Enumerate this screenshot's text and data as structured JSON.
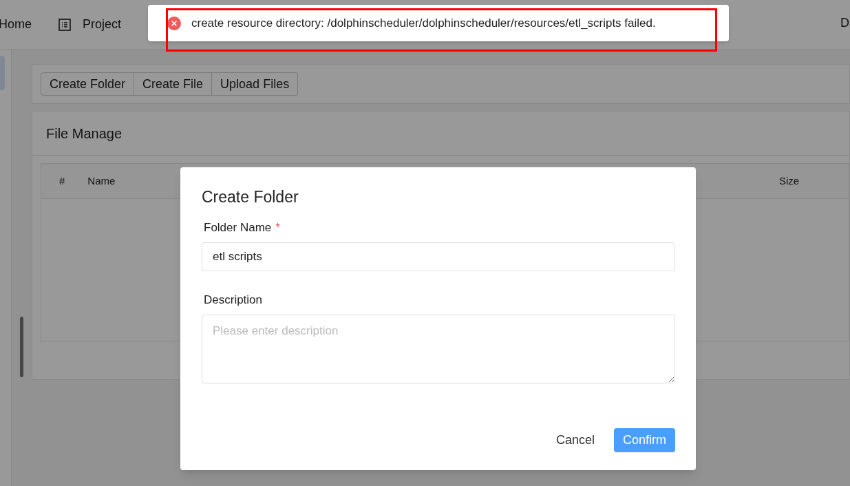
{
  "nav": {
    "items": [
      {
        "label": "Home",
        "kind": "plain"
      },
      {
        "label": "Project",
        "kind": "icon"
      }
    ],
    "user": "D"
  },
  "sidebar": {
    "items": [
      {
        "selected": true
      }
    ]
  },
  "toolbar": {
    "buttons": [
      "Create Folder",
      "Create File",
      "Upload Files"
    ]
  },
  "file_manage": {
    "title": "File Manage",
    "columns": [
      "#",
      "Name",
      "Size"
    ]
  },
  "dialog": {
    "title": "Create Folder",
    "fields": [
      {
        "kind": "input",
        "label": "Folder Name",
        "required_mark": "*",
        "value": "etl scripts"
      },
      {
        "kind": "textarea",
        "label": "Description",
        "placeholder": "Please enter description"
      }
    ],
    "buttons": [
      {
        "label": "Cancel",
        "kind": "text"
      },
      {
        "label": "Confirm",
        "kind": "primary"
      }
    ]
  },
  "message": {
    "kind": "error",
    "text": "create resource directory: /dolphinscheduler/dolphinscheduler/resources/etl_scripts failed.",
    "highlighted": true
  }
}
